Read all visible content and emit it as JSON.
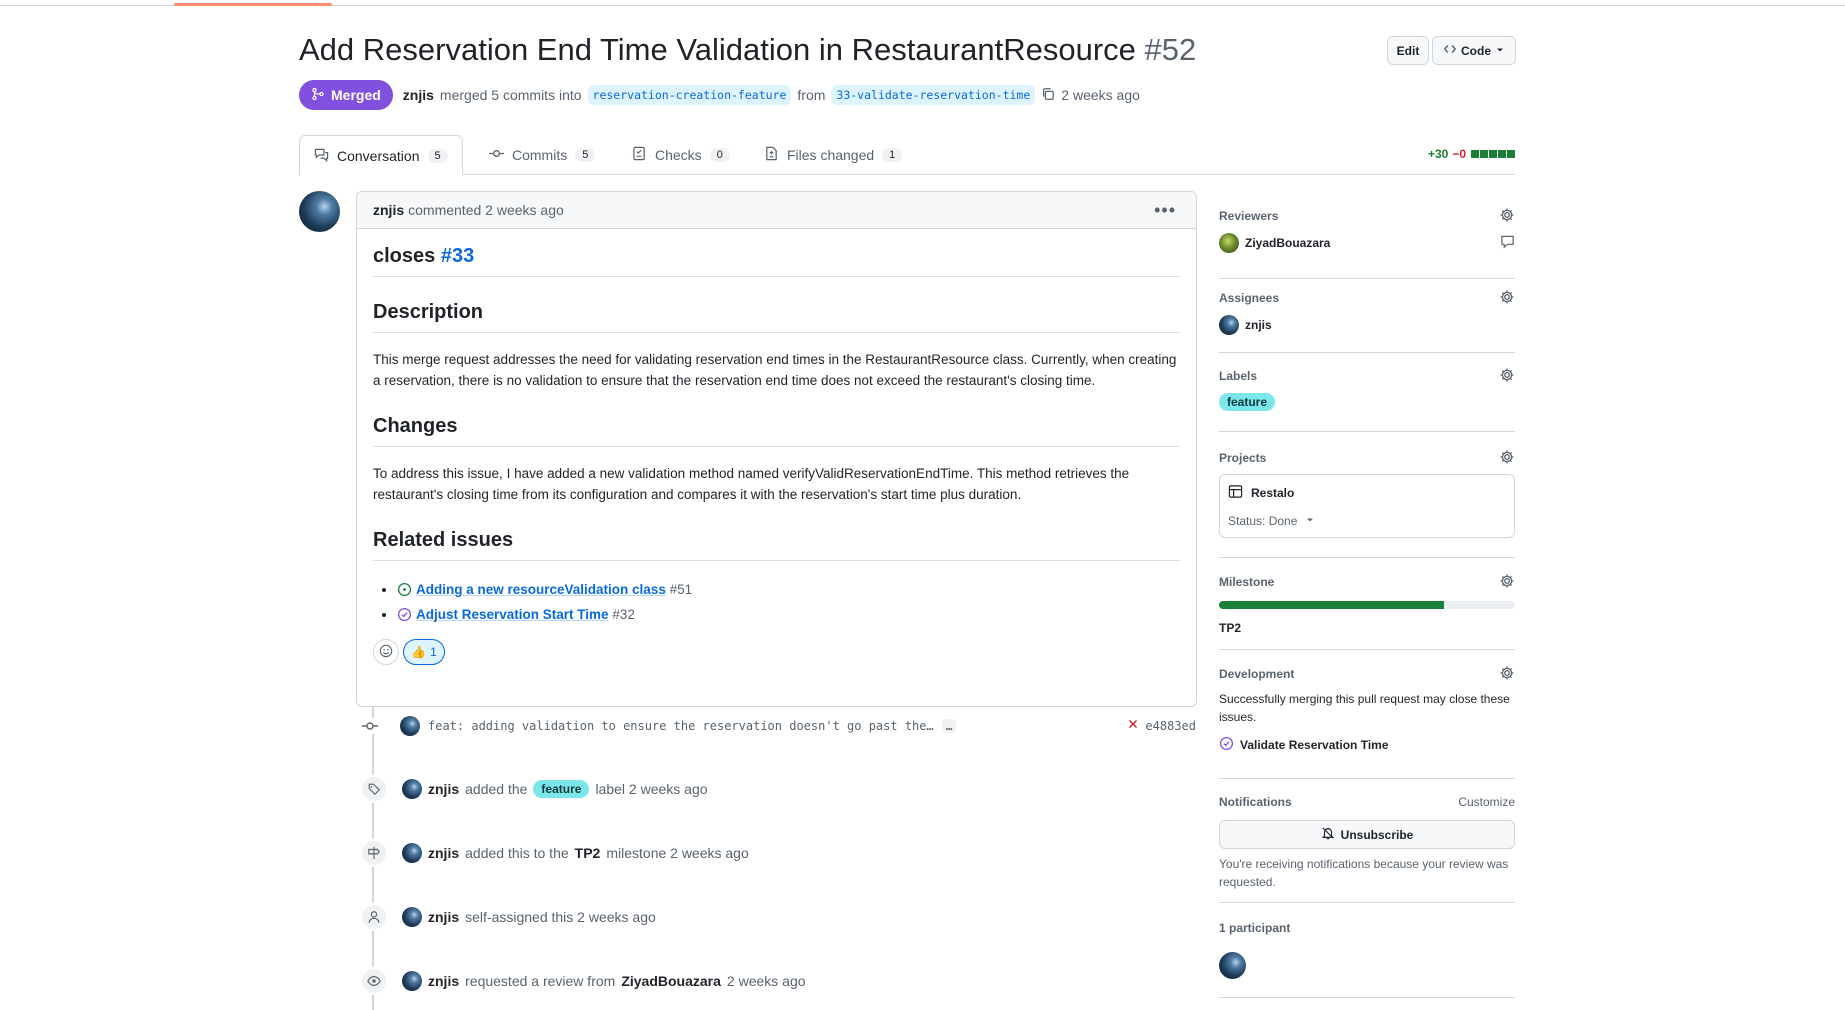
{
  "header": {
    "title": "Add Reservation End Time Validation in RestaurantResource",
    "number": "#52",
    "edit_label": "Edit",
    "code_label": "Code"
  },
  "meta": {
    "status": "Merged",
    "author": "znjis",
    "action_text": "merged 5 commits into",
    "base_branch": "reservation-creation-feature",
    "from_text": "from",
    "head_branch": "33-validate-reservation-time",
    "time": "2 weeks ago"
  },
  "tabs": [
    {
      "label": "Conversation",
      "count": "5"
    },
    {
      "label": "Commits",
      "count": "5"
    },
    {
      "label": "Checks",
      "count": "0"
    },
    {
      "label": "Files changed",
      "count": "1"
    }
  ],
  "diffstat": {
    "added": "+30",
    "removed": "−0",
    "color": "#1a7f37"
  },
  "comment": {
    "author": "znjis",
    "action": "commented 2 weeks ago",
    "closes_text": "closes",
    "closes_ref": "#33",
    "description_heading": "Description",
    "description_body": "This merge request addresses the need for validating reservation end times in the RestaurantResource class. Currently, when creating a reservation, there is no validation to ensure that the reservation end time does not exceed the restaurant's closing time.",
    "changes_heading": "Changes",
    "changes_body": "To address this issue, I have added a new validation method named verifyValidReservationEndTime. This method retrieves the restaurant's closing time from its configuration and compares it with the reservation's start time plus duration.",
    "related_heading": "Related issues",
    "related": [
      {
        "title": "Adding a new resourceValidation class",
        "number": "#51",
        "state": "open"
      },
      {
        "title": "Adjust Reservation Start Time",
        "number": "#32",
        "state": "closed"
      }
    ],
    "reaction_count": "1"
  },
  "commit": {
    "message": "feat: adding validation to ensure the reservation doesn't go past the…",
    "more": "…",
    "sha": "e4883ed",
    "status": "failure"
  },
  "timeline": [
    {
      "author": "znjis",
      "pre": "added the",
      "label": "feature",
      "post": "label 2 weeks ago"
    },
    {
      "author": "znjis",
      "pre": "added this to the",
      "strong": "TP2",
      "post": "milestone 2 weeks ago"
    },
    {
      "author": "znjis",
      "pre": "self-assigned this 2 weeks ago"
    },
    {
      "author": "znjis",
      "pre": "requested a review from",
      "strong": "ZiyadBouazara",
      "post": "2 weeks ago"
    }
  ],
  "sidebar": {
    "reviewers_heading": "Reviewers",
    "reviewer": "ZiyadBouazara",
    "assignees_heading": "Assignees",
    "assignee": "znjis",
    "labels_heading": "Labels",
    "label": "feature",
    "projects_heading": "Projects",
    "project_name": "Restalo",
    "project_status": "Status: Done",
    "milestone_heading": "Milestone",
    "milestone_name": "TP2",
    "milestone_progress": 0.76,
    "development_heading": "Development",
    "development_text": "Successfully merging this pull request may close these issues.",
    "development_issue": "Validate Reservation Time",
    "notifications_heading": "Notifications",
    "customize_label": "Customize",
    "unsubscribe_label": "Unsubscribe",
    "notifications_note": "You're receiving notifications because your review was requested.",
    "participants_heading": "1 participant"
  }
}
